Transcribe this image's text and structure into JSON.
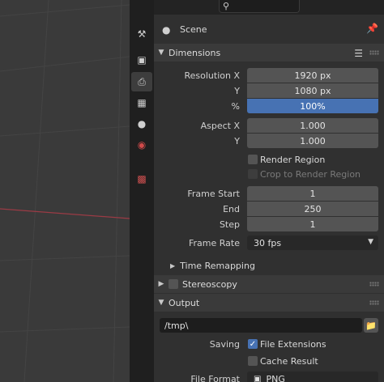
{
  "header": {
    "editor_type_icon": "properties-editor-icon",
    "search_icon": "search-icon"
  },
  "tabs": [
    {
      "name": "tool",
      "icon": "wrench-screwdriver-icon"
    },
    {
      "name": "render",
      "icon": "camera-back-icon"
    },
    {
      "name": "output",
      "icon": "printer-icon",
      "active": true
    },
    {
      "name": "view-layer",
      "icon": "image-stack-icon"
    },
    {
      "name": "scene",
      "icon": "scene-icon"
    },
    {
      "name": "world",
      "icon": "globe-icon"
    },
    {
      "name": "texture",
      "icon": "checker-texture-icon"
    }
  ],
  "context": {
    "scene_label": "Scene"
  },
  "dimensions": {
    "title": "Dimensions",
    "resolution_x_label": "Resolution X",
    "resolution_x": "1920 px",
    "resolution_y_label": "Y",
    "resolution_y": "1080 px",
    "percent_label": "%",
    "percent": "100%",
    "percent_value": 1.0,
    "aspect_x_label": "Aspect X",
    "aspect_x": "1.000",
    "aspect_y_label": "Y",
    "aspect_y": "1.000",
    "render_region_label": "Render Region",
    "render_region_checked": false,
    "crop_label": "Crop to Render Region",
    "crop_checked": false,
    "frame_start_label": "Frame Start",
    "frame_start": "1",
    "frame_end_label": "End",
    "frame_end": "250",
    "frame_step_label": "Step",
    "frame_step": "1",
    "frame_rate_label": "Frame Rate",
    "frame_rate": "30 fps",
    "time_remapping_label": "Time Remapping"
  },
  "stereoscopy": {
    "title": "Stereoscopy",
    "checked": false
  },
  "output": {
    "title": "Output",
    "path": "/tmp\\",
    "saving_label": "Saving",
    "file_extensions_label": "File Extensions",
    "file_extensions_checked": true,
    "cache_result_label": "Cache Result",
    "cache_result_checked": false,
    "file_format_label": "File Format",
    "file_format": "PNG"
  },
  "colors": {
    "accent": "#4772b3",
    "panel": "#303030",
    "field": "#545454",
    "viewport": "#3a3a3a"
  }
}
